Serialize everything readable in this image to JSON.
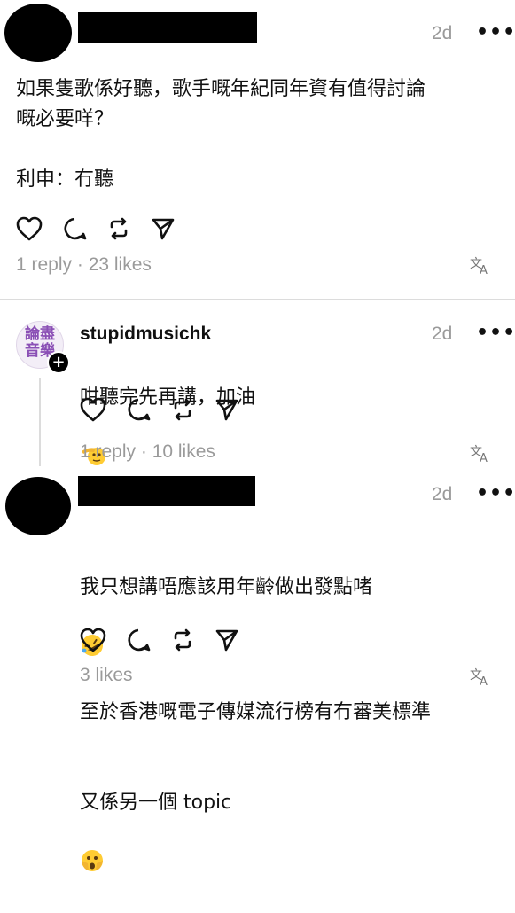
{
  "posts": [
    {
      "time": "2d",
      "text": "如果隻歌係好聽，歌手嘅年紀同年資有值得討論\n嘅必要咩？\n\n利申：冇聽",
      "stats": "1 reply · 23 likes"
    },
    {
      "username": "stupidmusichk",
      "avatar_text": "論盡\n音樂",
      "time": "2d",
      "text": "咁聽完先再講，加油",
      "stats": "1 reply · 10 likes"
    },
    {
      "time": "2d",
      "text_line1": "我只想講唔應該用年齡做出發點啫",
      "text_line2": "至於香港嘅電子傳媒流行榜有冇審美標準",
      "text_line3": "又係另一個 topic",
      "stats": "3 likes"
    }
  ],
  "colors": {
    "muted": "#9a9a9a",
    "accent_purple": "#8a4fb5"
  },
  "icons": [
    "more-icon",
    "like-icon",
    "reply-icon",
    "repost-icon",
    "share-icon",
    "translate-icon",
    "follow-plus-icon"
  ]
}
